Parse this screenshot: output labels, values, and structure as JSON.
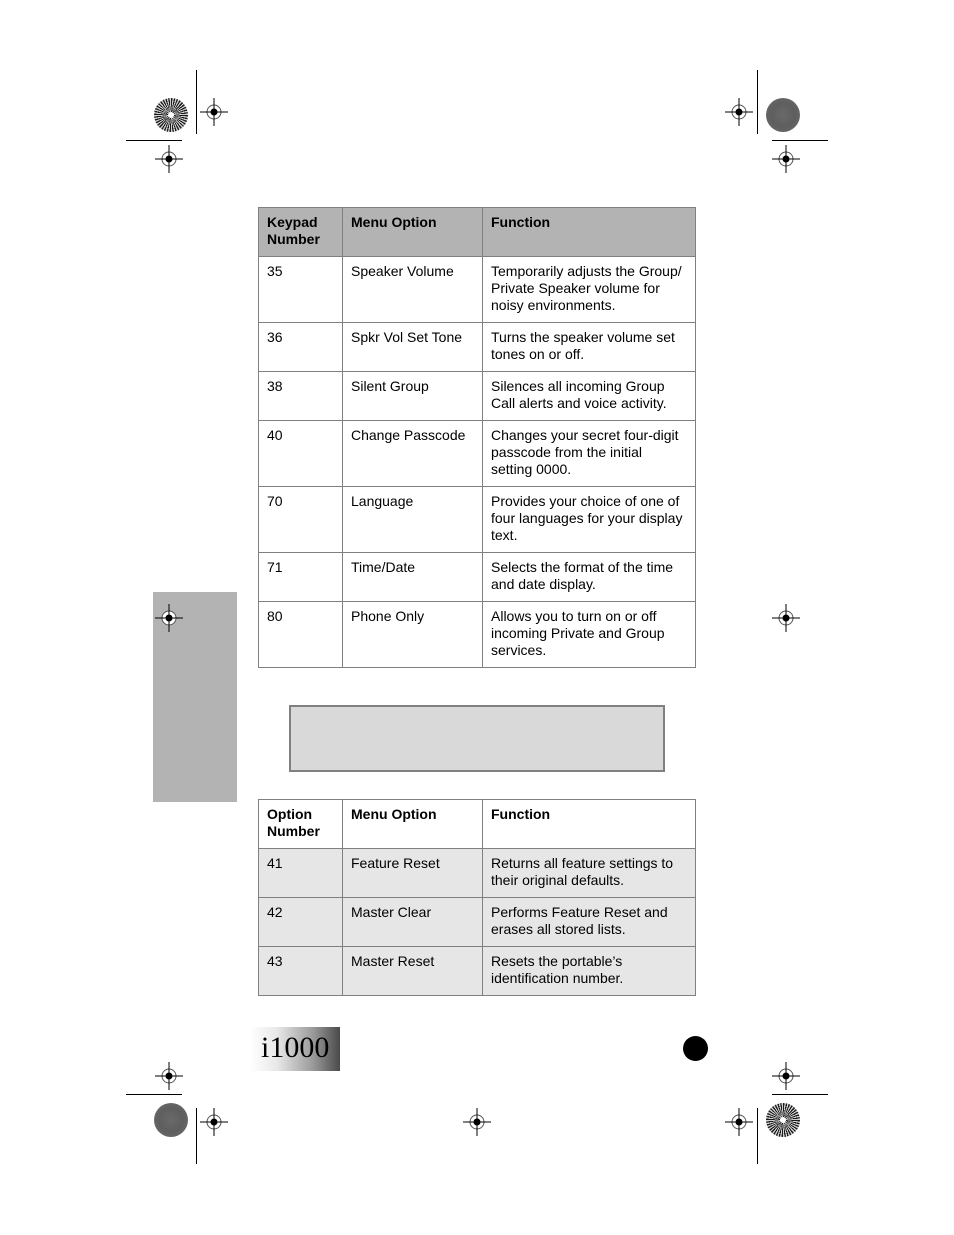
{
  "table_keypad": {
    "headers": [
      "Keypad Number",
      "Menu Option",
      "Function"
    ],
    "rows": [
      {
        "number": "35",
        "option": "Speaker Volume",
        "function": "Temporarily adjusts the Group/ Private Speaker volume for noisy environments."
      },
      {
        "number": "36",
        "option": "Spkr Vol Set Tone",
        "function": "Turns the speaker volume set tones on or off."
      },
      {
        "number": "38",
        "option": "Silent Group",
        "function": "Silences all incoming Group Call alerts and voice activity."
      },
      {
        "number": "40",
        "option": "Change Passcode",
        "function": "Changes your secret four-digit passcode from the initial setting 0000."
      },
      {
        "number": "70",
        "option": "Language",
        "function": "Provides your choice of one of four languages for your display text."
      },
      {
        "number": "71",
        "option": "Time/Date",
        "function": "Selects the format of the time and date display."
      },
      {
        "number": "80",
        "option": "Phone Only",
        "function": "Allows you to turn on or off incoming Private and Group services."
      }
    ]
  },
  "table_option": {
    "headers": [
      "Option Number",
      "Menu Option",
      "Function"
    ],
    "rows": [
      {
        "number": "41",
        "option": "Feature Reset",
        "function": "Returns all feature settings to their original defaults."
      },
      {
        "number": "42",
        "option": "Master Clear",
        "function": "Performs Feature Reset and erases all stored lists."
      },
      {
        "number": "43",
        "option": "Master Reset",
        "function": "Resets the portable’s identification number."
      }
    ]
  },
  "footer": {
    "model_logo": "i1000"
  },
  "colors": {
    "header_gray": "#b3b3b3",
    "row_gray": "#e6e6e6",
    "note_gray": "#d9d9d9",
    "border_gray": "#808080"
  }
}
